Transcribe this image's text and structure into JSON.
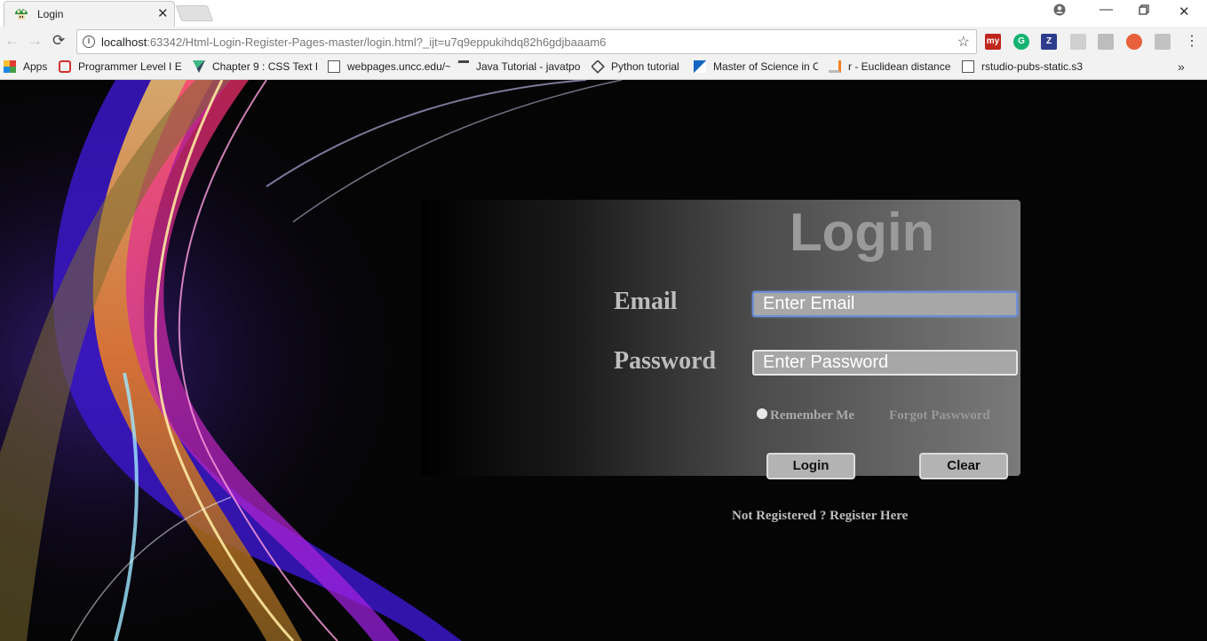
{
  "browser": {
    "tab_title": "Login",
    "url_host": "localhost",
    "url_rest": ":63342/Html-Login-Register-Pages-master/login.html?_ijt=u7q9eppukihdq82h6gdjbaaam6",
    "extensions": [
      {
        "icon": "my-extension-icon",
        "label": "my",
        "color": "#c0261c"
      },
      {
        "icon": "grammarly-icon",
        "label": "G",
        "color": "#15b371"
      },
      {
        "icon": "zotero-icon",
        "label": "Z",
        "color": "#2d3c8c"
      },
      {
        "icon": "extension-icon",
        "label": "",
        "color": "#cfcfcf"
      },
      {
        "icon": "pdf-icon",
        "label": "",
        "color": "#bdbdbd"
      },
      {
        "icon": "adblock-icon",
        "label": "",
        "color": "#e8603c"
      },
      {
        "icon": "cube-icon",
        "label": "",
        "color": "#c2c2c2"
      }
    ],
    "bookmarks": [
      {
        "label": "Apps",
        "icon": "apps-grid-icon"
      },
      {
        "label": "Programmer Level I E",
        "icon": "oracle-icon"
      },
      {
        "label": "Chapter 9 : CSS Text F",
        "icon": "vue-icon"
      },
      {
        "label": "webpages.uncc.edu/~",
        "icon": "page-icon"
      },
      {
        "label": "Java Tutorial - javatpo",
        "icon": "text-t-icon"
      },
      {
        "label": "Python tutorial",
        "icon": "diamond-icon"
      },
      {
        "label": "Master of Science in C",
        "icon": "flag-icon"
      },
      {
        "label": "r - Euclidean distance",
        "icon": "stackoverflow-icon"
      },
      {
        "label": "rstudio-pubs-static.s3",
        "icon": "page-icon"
      }
    ],
    "bookmarks_more": "»"
  },
  "login": {
    "title": "Login",
    "email_label": "Email",
    "email_placeholder": "Enter Email",
    "password_label": "Password",
    "password_placeholder": "Enter Password",
    "remember_label": "Remember Me",
    "forgot_label": "Forgot Paswword",
    "login_button": "Login",
    "clear_button": "Clear",
    "register_link": "Not Registered ? Register Here"
  }
}
